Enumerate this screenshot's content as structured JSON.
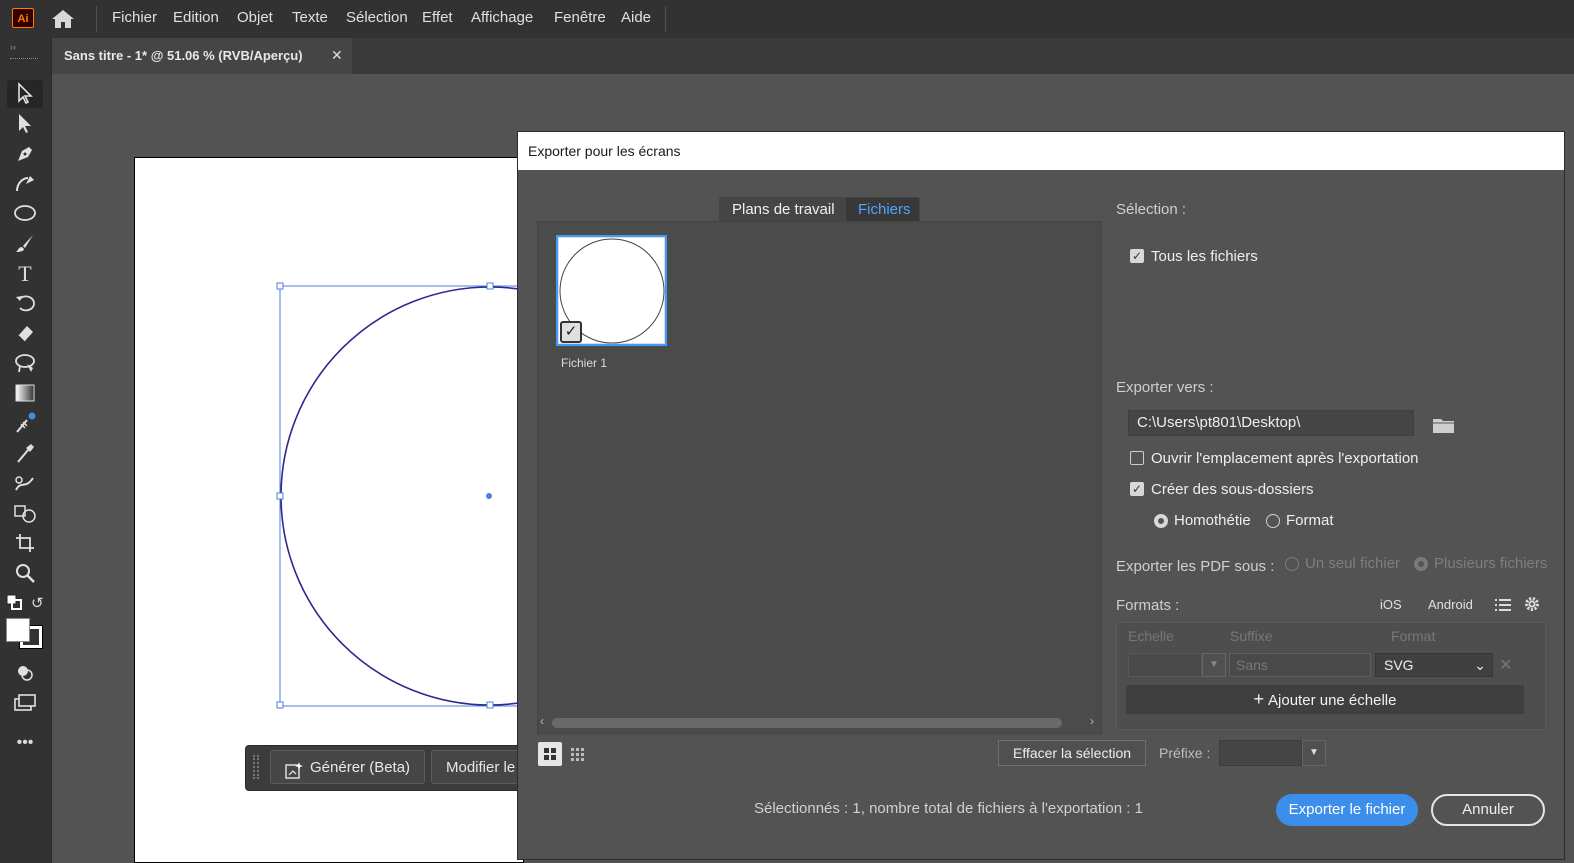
{
  "app": {
    "logo": "Ai",
    "menu": [
      "Fichier",
      "Edition",
      "Objet",
      "Texte",
      "Sélection",
      "Effet",
      "Affichage",
      "Fenêtre",
      "Aide"
    ],
    "document_tab": "Sans titre - 1* @ 51.06 % (RVB/Aperçu)",
    "close_glyph": "✕"
  },
  "context_bar": {
    "generate": "Générer (Beta)",
    "modify": "Modifier le"
  },
  "dialog": {
    "title": "Exporter pour les écrans",
    "tabs": [
      "Plans de travail",
      "Fichiers"
    ],
    "active_tab": "Fichiers",
    "thumbnail_label": "Fichier 1",
    "selection_label": "Sélection :",
    "all_files": "Tous les fichiers",
    "export_to_label": "Exporter vers :",
    "export_path": "C:\\Users\\pt801\\Desktop\\",
    "open_location": "Ouvrir l'emplacement après l'exportation",
    "create_subfolders": "Créer des sous-dossiers",
    "radio_scale": "Homothétie",
    "radio_format": "Format",
    "pdf_label": "Exporter les PDF sous :",
    "pdf_single": "Un seul fichier",
    "pdf_multiple": "Plusieurs fichiers",
    "formats_label": "Formats :",
    "ios": "iOS",
    "android": "Android",
    "col_scale": "Echelle",
    "col_suffix": "Suffixe",
    "col_format": "Format",
    "suffix_placeholder": "Sans",
    "format_value": "SVG",
    "add_scale": "Ajouter une échelle",
    "clear_selection": "Effacer la sélection",
    "prefix_label": "Préfixe :",
    "status": "Sélectionnés : 1, nombre total de fichiers à l'exportation : 1",
    "export_button": "Exporter le fichier",
    "cancel_button": "Annuler"
  },
  "colors": {
    "accent": "#3b8eea",
    "circle_stroke": "#2b2a8f",
    "selection_blue": "#4a7fe0"
  }
}
